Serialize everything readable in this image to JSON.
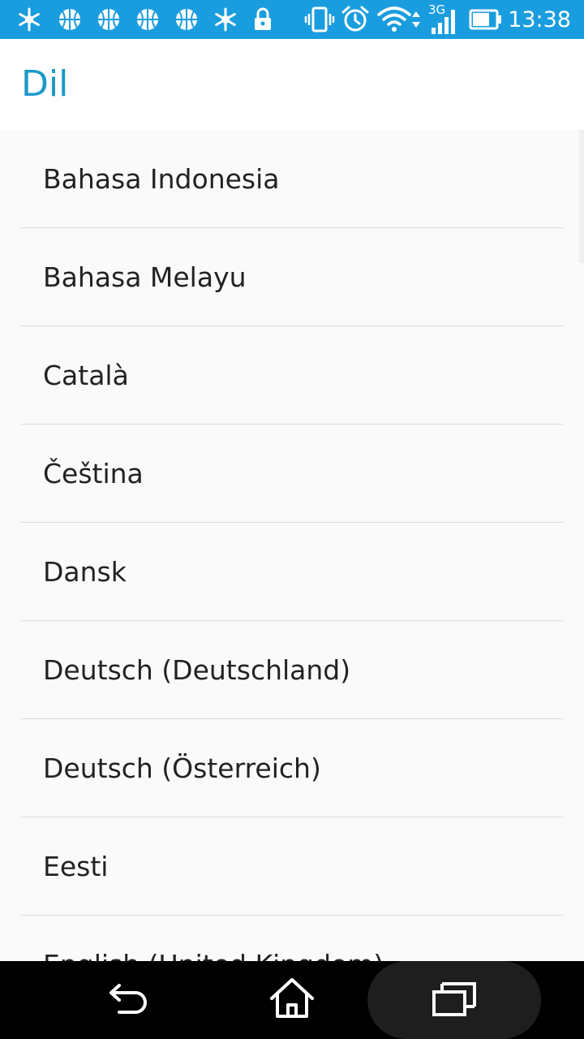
{
  "status_bar": {
    "time": "13:38",
    "network_label": "3G",
    "colors": {
      "background": "#1a9ddf",
      "foreground": "#ffffff"
    },
    "notification_icons": [
      "snowflake-icon",
      "basketball-icon",
      "basketball-icon",
      "basketball-icon",
      "basketball-icon",
      "snowflake-icon",
      "lock-icon"
    ],
    "system_icons": [
      "vibrate-icon",
      "alarm-icon",
      "wifi-icon",
      "cellular-signal-icon",
      "battery-icon"
    ]
  },
  "header": {
    "title": "Dil",
    "title_color": "#1c99c9"
  },
  "languages": [
    {
      "label": "Bahasa Indonesia"
    },
    {
      "label": "Bahasa Melayu"
    },
    {
      "label": "Català"
    },
    {
      "label": "Čeština"
    },
    {
      "label": "Dansk"
    },
    {
      "label": "Deutsch (Deutschland)"
    },
    {
      "label": "Deutsch (Österreich)"
    },
    {
      "label": "Eesti"
    },
    {
      "label": "English (United Kingdom)"
    }
  ],
  "nav_bar": {
    "buttons": [
      "back-icon",
      "home-icon",
      "recents-icon"
    ]
  }
}
